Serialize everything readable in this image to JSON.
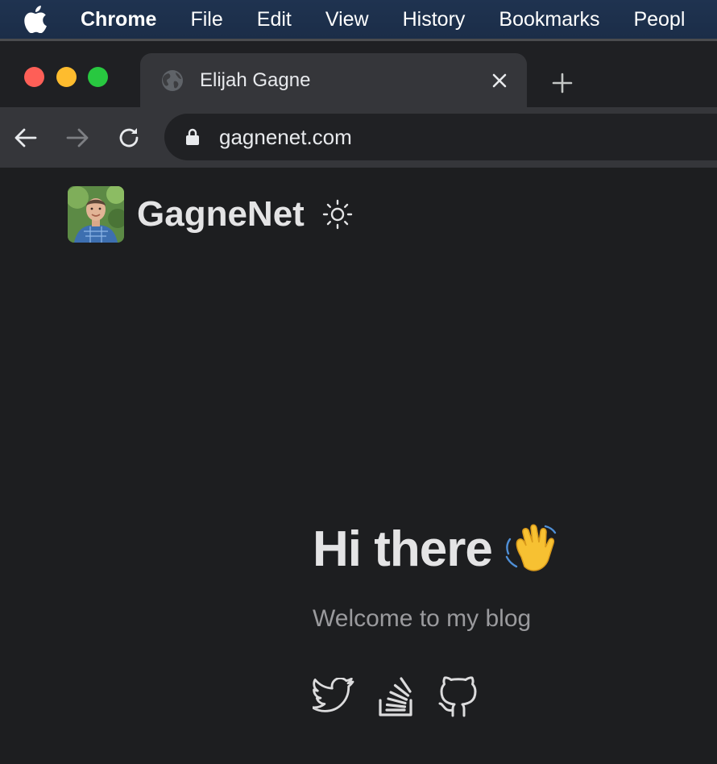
{
  "menubar": {
    "apple_icon": "apple-logo-icon",
    "items": [
      "Chrome",
      "File",
      "Edit",
      "View",
      "History",
      "Bookmarks",
      "Peopl"
    ]
  },
  "browser": {
    "tab": {
      "title": "Elijah Gagne",
      "favicon": "globe-icon"
    },
    "omnibox": {
      "url": "gagnenet.com",
      "icon": "lock-icon"
    }
  },
  "site": {
    "title": "GagneNet",
    "theme_toggle_icon": "sun-icon",
    "hero": {
      "heading": "Hi there",
      "emoji": "waving-hand",
      "subheading": "Welcome to my blog"
    },
    "social_icons": [
      "twitter-icon",
      "stackoverflow-icon",
      "github-icon"
    ]
  },
  "colors": {
    "background": "#1d1e20",
    "menubar": "#1f3350",
    "tab_active": "#35363a",
    "text": "#e4e4e5",
    "muted": "#9a9a9d"
  }
}
